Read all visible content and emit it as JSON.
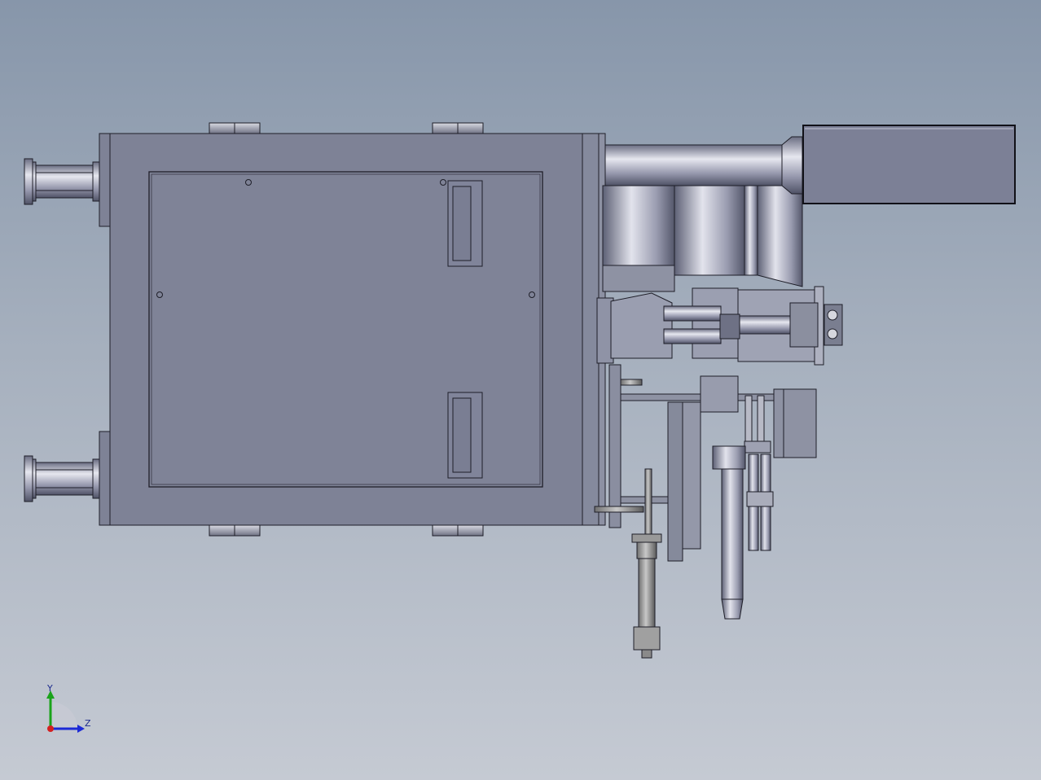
{
  "viewport": {
    "background_top": "#8796aa",
    "background_bottom": "#c5cad3",
    "body_color": "#7e8296",
    "edge_color": "#1e1e28",
    "metal_light": "#dfe0ea",
    "metal_dark": "#5c5f72"
  },
  "triad": {
    "y_label": "Y",
    "z_label": "Z",
    "y_color": "#1aa31a",
    "z_color": "#1c2ad6",
    "origin_color": "#d42020"
  }
}
